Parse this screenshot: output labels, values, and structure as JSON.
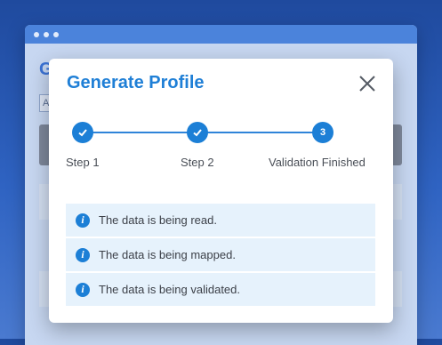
{
  "background": {
    "page_title_initial": "G",
    "field_initial": "A"
  },
  "modal": {
    "title": "Generate Profile",
    "close_icon": "close-icon"
  },
  "stepper": {
    "steps": [
      {
        "label": "Step 1",
        "state": "complete"
      },
      {
        "label": "Step 2",
        "state": "complete"
      },
      {
        "label": "Validation Finished",
        "state": "current",
        "number": "3"
      }
    ]
  },
  "messages": [
    {
      "icon": "info-icon",
      "text": "The data is being read."
    },
    {
      "icon": "info-icon",
      "text": "The data is being mapped."
    },
    {
      "icon": "info-icon",
      "text": "The data is being validated."
    }
  ],
  "colors": {
    "accent": "#1c7fd6",
    "info_bg": "#e6f2fc",
    "titlebar": "#4b83db"
  }
}
